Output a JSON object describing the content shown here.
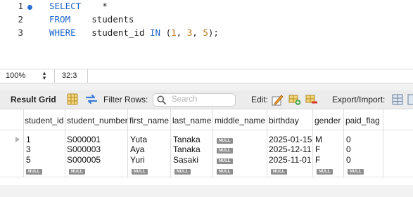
{
  "editor": {
    "lines": [
      {
        "number": "1",
        "breakpoint": true,
        "keyword": "SELECT",
        "rest": "*"
      },
      {
        "number": "2",
        "breakpoint": false,
        "keyword": "FROM",
        "rest": "students"
      },
      {
        "number": "3",
        "breakpoint": false,
        "keyword": "WHERE",
        "column": "student_id",
        "op": "IN",
        "open": "(",
        "v1": "1",
        "c1": ", ",
        "v2": "3",
        "c2": ", ",
        "v3": "5",
        "close": ");"
      }
    ]
  },
  "status": {
    "zoom": "100%",
    "cursor": "32:3"
  },
  "toolbar": {
    "result_grid": "Result Grid",
    "filter_rows": "Filter Rows:",
    "search_placeholder": "Search",
    "edit": "Edit:",
    "export_import": "Export/Import:"
  },
  "grid": {
    "columns": [
      "student_id",
      "student_number",
      "first_name",
      "last_name",
      "middle_name",
      "birthday",
      "gender",
      "paid_flag"
    ],
    "null_label": "NULL",
    "rows": [
      [
        "1",
        "S000001",
        "Yuta",
        "Tanaka",
        null,
        "2025-01-15",
        "M",
        "0"
      ],
      [
        "3",
        "S000003",
        "Aya",
        "Tanaka",
        null,
        "2025-12-11",
        "F",
        "0"
      ],
      [
        "5",
        "S000005",
        "Yuri",
        "Sasaki",
        null,
        "2025-11-01",
        "F",
        "0"
      ]
    ]
  },
  "colors": {
    "keyword": "#1d63c7",
    "number": "#b8741a",
    "breakpoint": "#2a6fd6",
    "null_badge": "#8e8e8e"
  }
}
